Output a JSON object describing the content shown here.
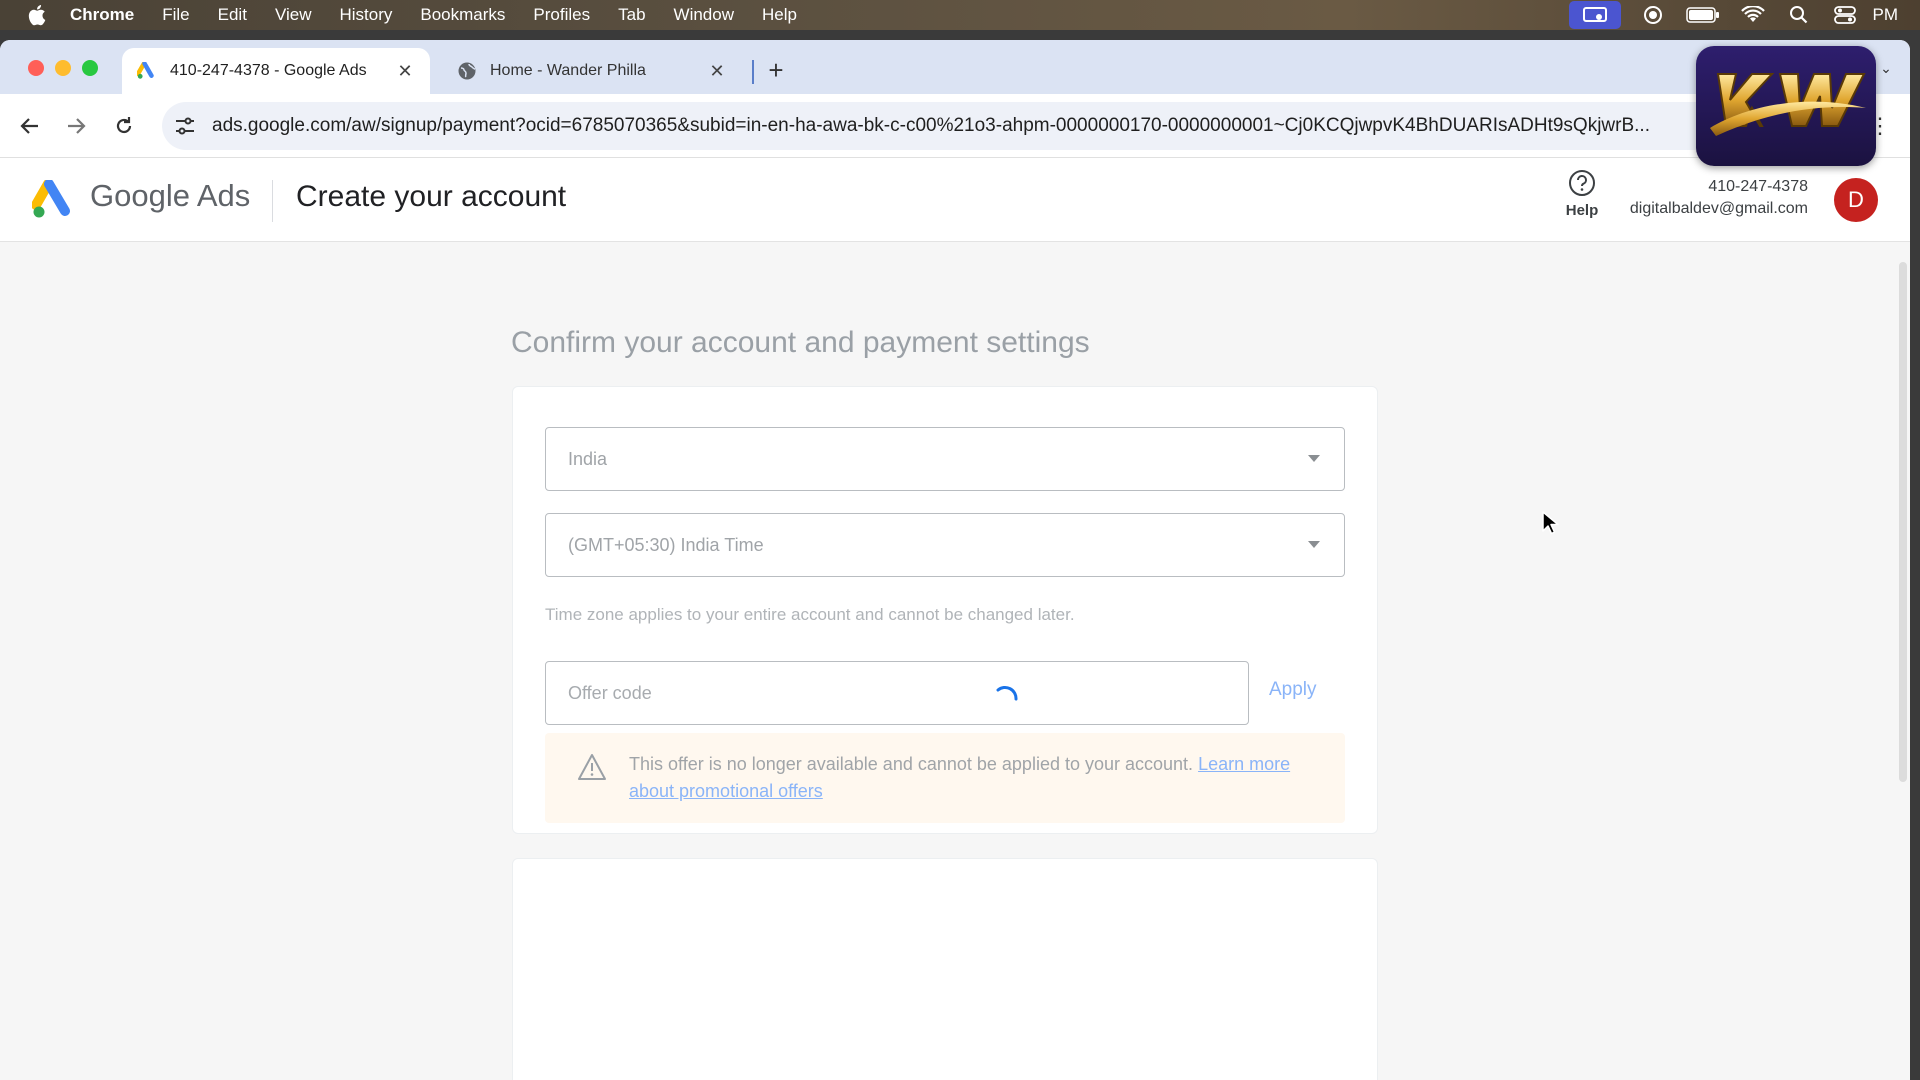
{
  "menubar": {
    "app_name": "Chrome",
    "items": [
      "File",
      "Edit",
      "View",
      "History",
      "Bookmarks",
      "Profiles",
      "Tab",
      "Window",
      "Help"
    ],
    "clock": "PM"
  },
  "browser": {
    "tabs": [
      {
        "title": "410-247-4378 - Google Ads",
        "icon": "google-ads-icon",
        "active": true
      },
      {
        "title": "Home - Wander Philla",
        "icon": "globe-icon",
        "active": false
      }
    ],
    "url": "ads.google.com/aw/signup/payment?ocid=6785070365&subid=in-en-ha-awa-bk-c-c00%21o3-ahpm-0000000170-0000000001~Cj0KCQjwpvK4BhDUARIsADHt9sQkjwrB..."
  },
  "header": {
    "brand": "Google Ads",
    "title": "Create your account",
    "help_label": "Help",
    "account_id": "410-247-4378",
    "account_email": "digitalbaldev@gmail.com",
    "avatar_initial": "D"
  },
  "main": {
    "section_title": "Confirm your account and payment settings",
    "country": "India",
    "timezone": "(GMT+05:30) India Time",
    "timezone_hint": "Time zone applies to your entire account and cannot be changed later.",
    "offer_placeholder": "Offer code",
    "apply_label": "Apply",
    "alert_text": "This offer is no longer available and cannot be applied to your account.",
    "alert_link": "Learn more about promotional offers"
  },
  "colors": {
    "accent_blue": "#8ab4f8",
    "avatar_red": "#c5221f",
    "alert_bg": "#fff8ef"
  }
}
